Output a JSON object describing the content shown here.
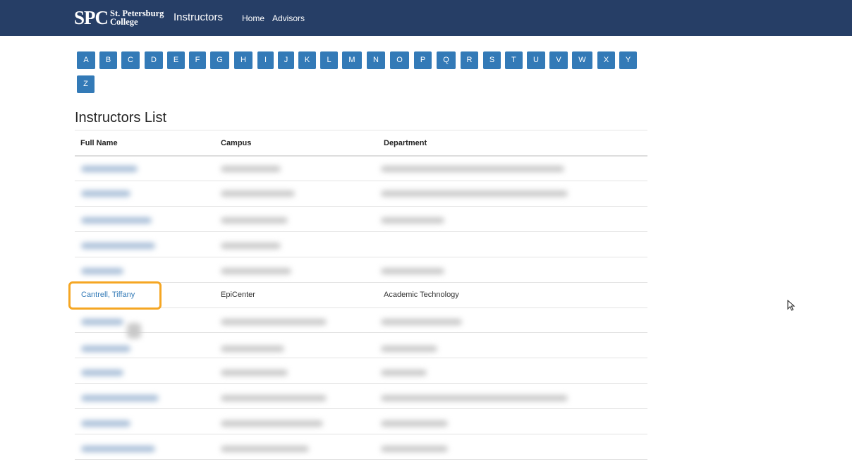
{
  "navbar": {
    "logo_spc": "SPC",
    "logo_line1": "St. Petersburg",
    "logo_line2": "College",
    "brand_title": "Instructors",
    "links": [
      "Home",
      "Advisors"
    ]
  },
  "letters": [
    "A",
    "B",
    "C",
    "D",
    "E",
    "F",
    "G",
    "H",
    "I",
    "J",
    "K",
    "L",
    "M",
    "N",
    "O",
    "P",
    "Q",
    "R",
    "S",
    "T",
    "U",
    "V",
    "W",
    "X",
    "Y",
    "Z"
  ],
  "list_title": "Instructors List",
  "table": {
    "headers": [
      "Full Name",
      "Campus",
      "Department"
    ],
    "highlighted_row": {
      "name": "Cantrell, Tiffany",
      "campus": "EpiCenter",
      "department": "Academic Technology"
    }
  },
  "colors": {
    "navbar": "#263e66",
    "letter_button": "#337ab7",
    "link": "#337ab7",
    "highlight": "#f5a623"
  }
}
